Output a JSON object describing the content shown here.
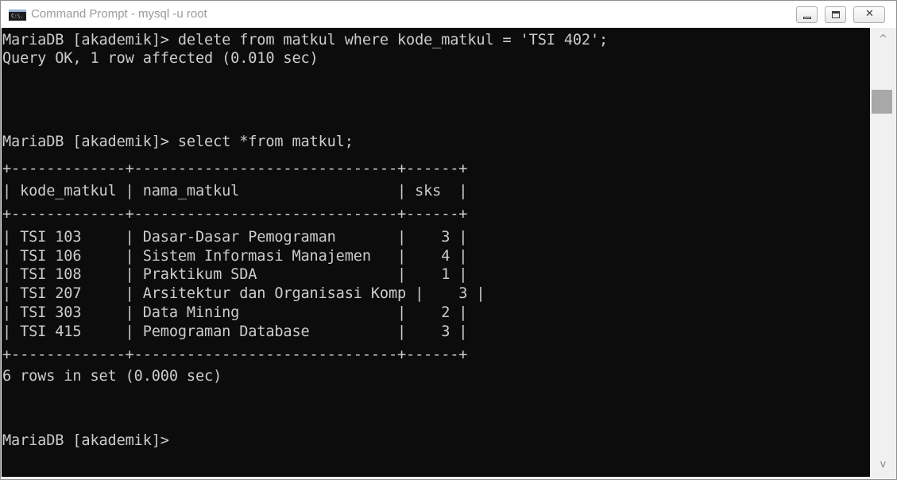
{
  "window": {
    "title": "Command Prompt - mysql  -u root",
    "icon": "command-prompt-icon",
    "icon_text": "C:\\.",
    "controls": {
      "minimize": "minimize-icon",
      "maximize": "maximize-icon",
      "close": "close-icon",
      "close_glyph": "✕"
    }
  },
  "console": {
    "lines": [
      "MariaDB [akademik]> delete from matkul where kode_matkul = 'TSI 402';",
      "Query OK, 1 row affected (0.010 sec)",
      "",
      "MariaDB [akademik]> select *from matkul;",
      "+-------------+------------------------------+------+",
      "| kode_matkul | nama_matkul                  | sks  |",
      "+-------------+------------------------------+------+",
      "| TSI 103     | Dasar-Dasar Pemograman       |    3 |",
      "| TSI 106     | Sistem Informasi Manajemen   |    4 |",
      "| TSI 108     | Praktikum SDA                |    1 |",
      "| TSI 207     | Arsitektur dan Organisasi Komp |    3 |",
      "| TSI 303     | Data Mining                  |    2 |",
      "| TSI 415     | Pemograman Database          |    3 |",
      "+-------------+------------------------------+------+",
      "6 rows in set (0.000 sec)",
      "",
      "MariaDB [akademik]>"
    ],
    "text_color": "#cccccc",
    "background_color": "#0c0c0c"
  },
  "scrollbar": {
    "up_arrow": "^",
    "down_arrow": "v",
    "up_icon": "chevron-up-icon",
    "down_icon": "chevron-down-icon"
  }
}
